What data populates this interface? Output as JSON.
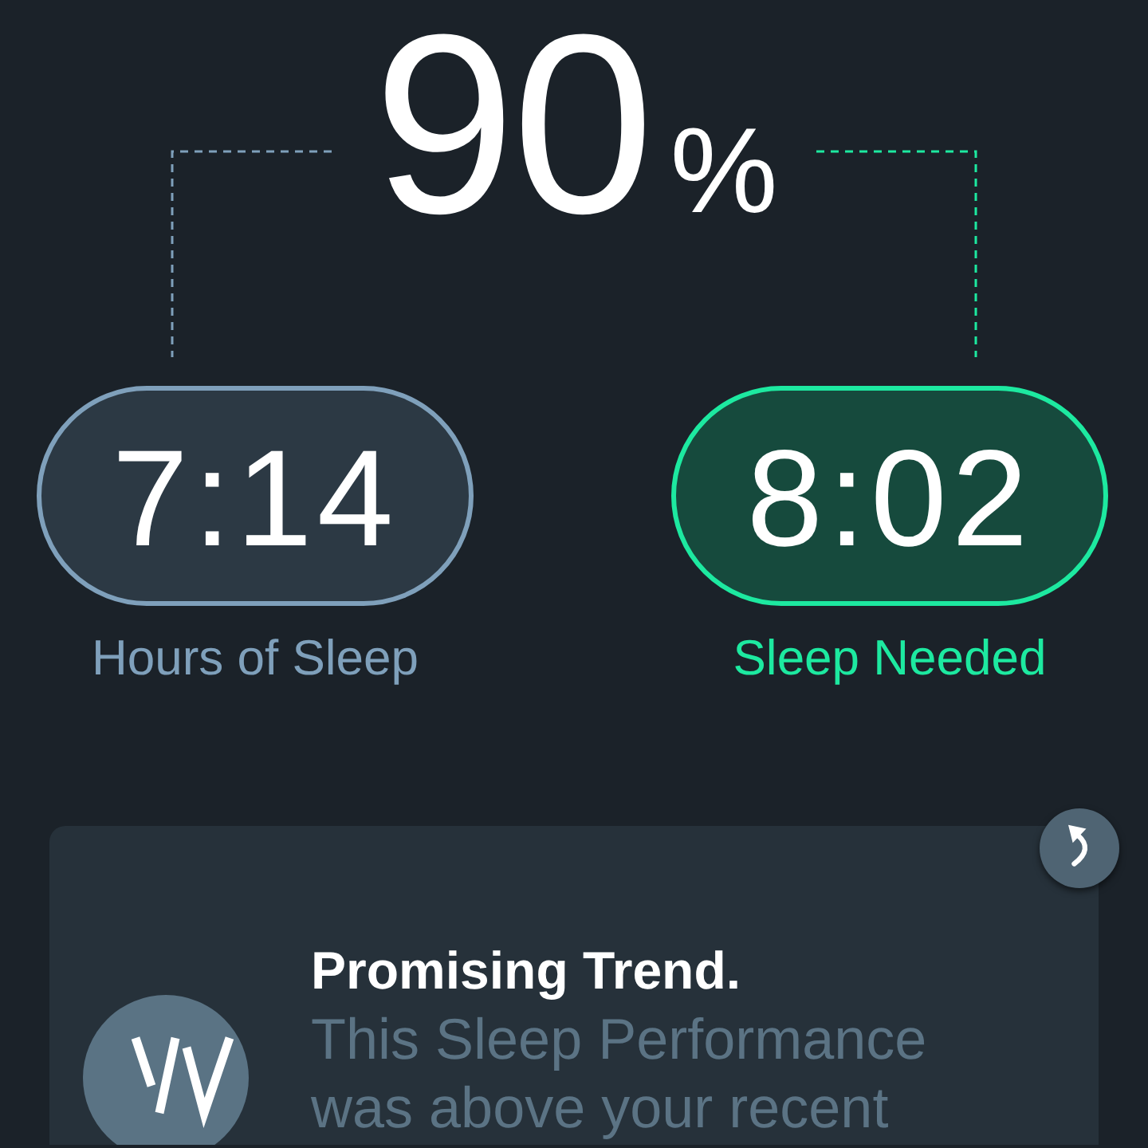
{
  "score": {
    "value": "90",
    "unit": "%"
  },
  "metrics": [
    {
      "kind": "actual",
      "value": "7:14",
      "label": "Hours of Sleep"
    },
    {
      "kind": "needed",
      "value": "8:02",
      "label": "Sleep Needed"
    }
  ],
  "insight": {
    "title": "Promising Trend.",
    "body": "This Sleep Performance was above your recent"
  }
}
